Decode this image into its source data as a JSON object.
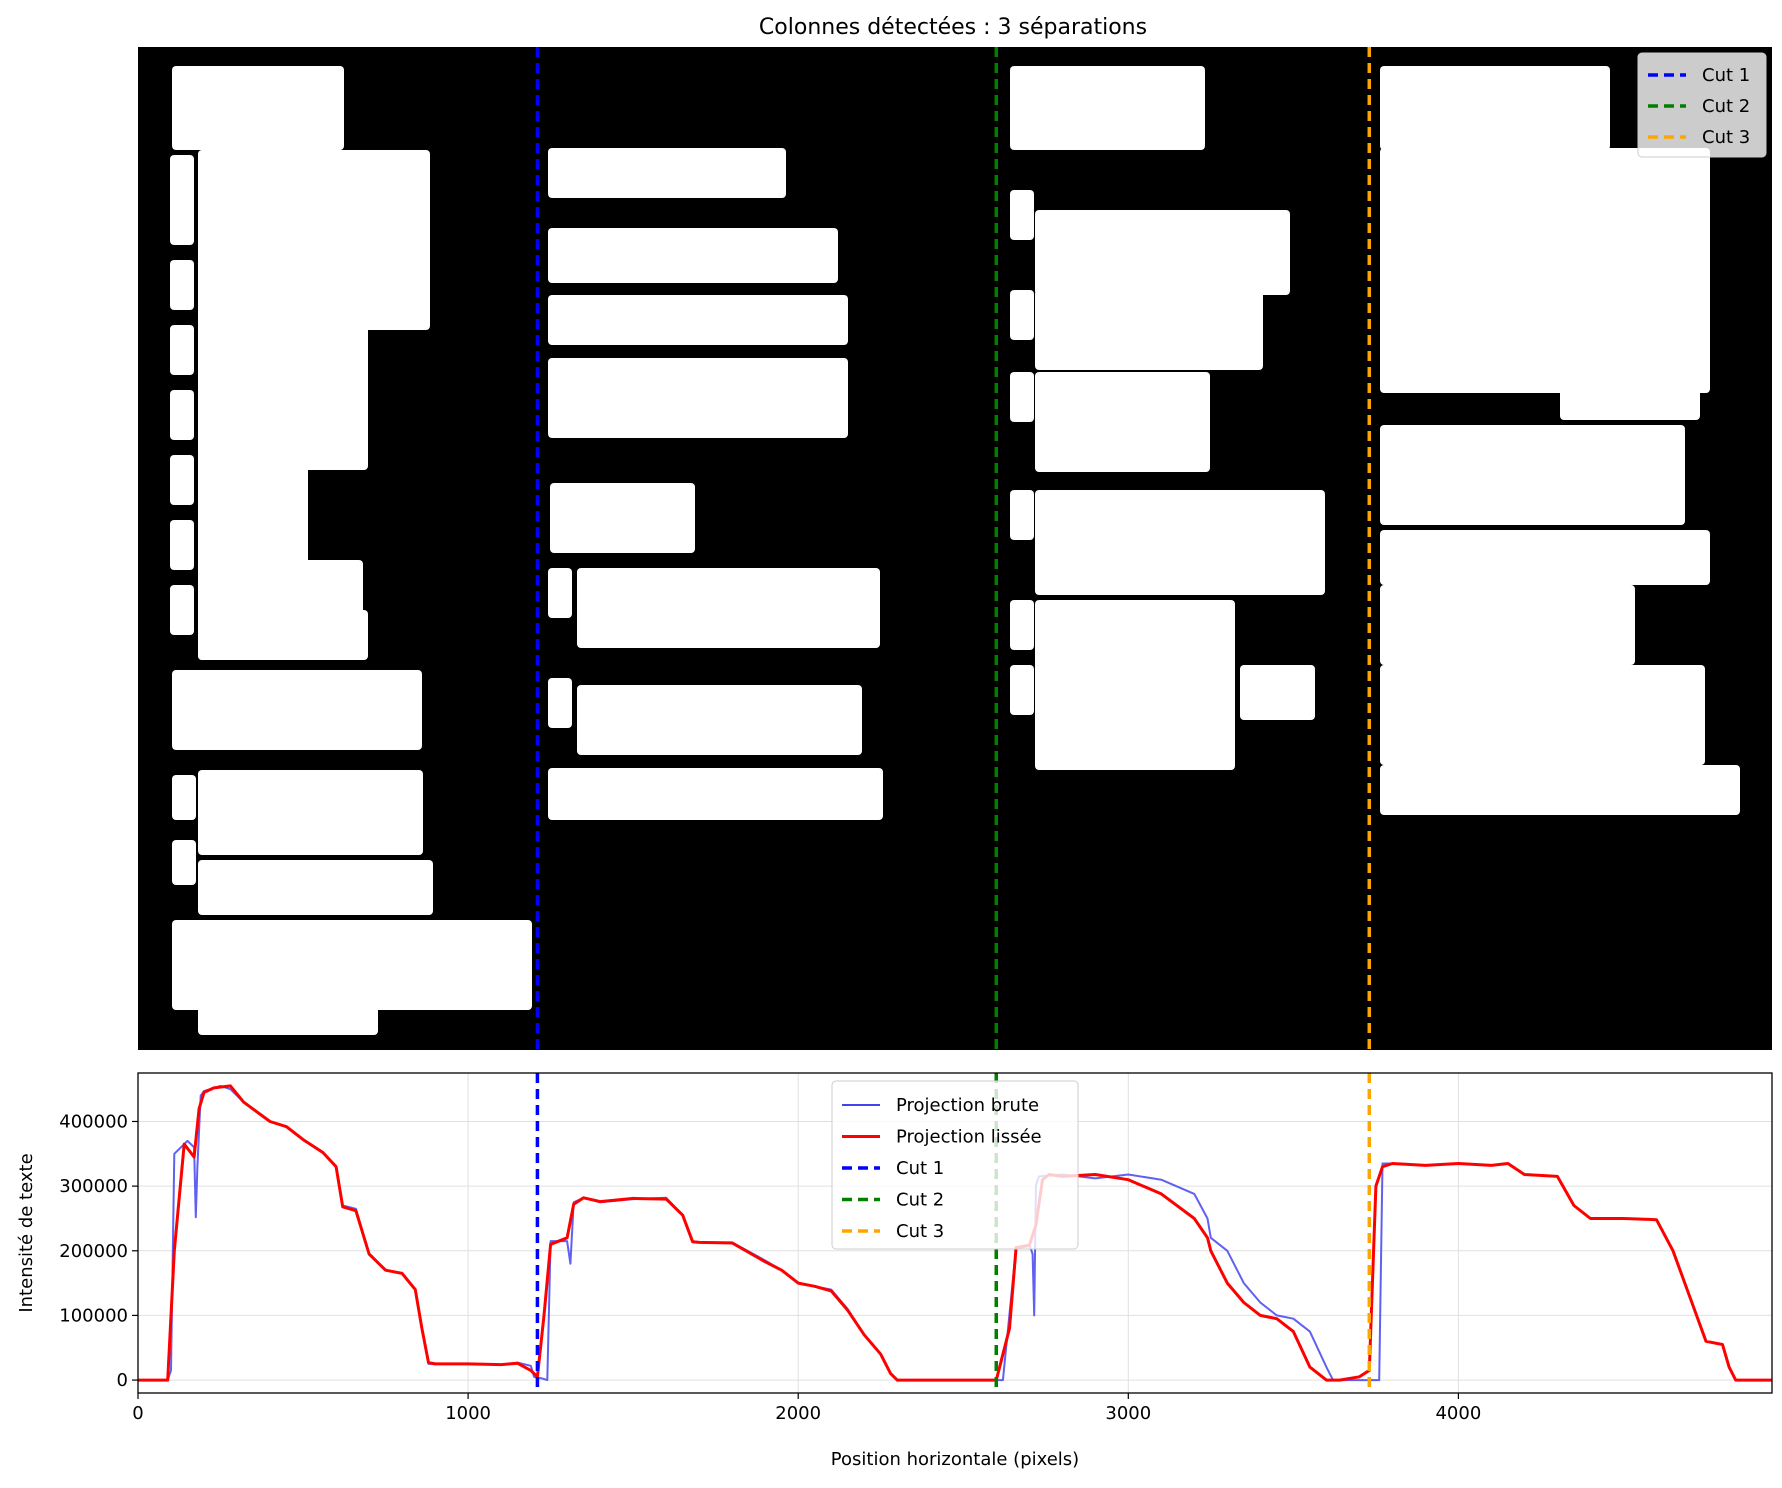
{
  "figure": {
    "title": "Colonnes détectées : 3 séparations"
  },
  "chart_data": [
    {
      "type": "image",
      "description_role": "binarized-page-mask",
      "x_range": [
        0,
        4950
      ],
      "cuts": [
        {
          "name": "Cut 1",
          "x": 1210,
          "color": "#0000ff"
        },
        {
          "name": "Cut 2",
          "x": 2600,
          "color": "#008000"
        },
        {
          "name": "Cut 3",
          "x": 3730,
          "color": "#ffa500"
        }
      ],
      "legend": {
        "placement": "top-right",
        "entries": [
          "Cut 1",
          "Cut 2",
          "Cut 3"
        ]
      },
      "background_color": "#000000",
      "foreground_color": "#ffffff"
    },
    {
      "type": "line",
      "xlabel": "Position horizontale (pixels)",
      "ylabel": "Intensité de texte",
      "xlim": [
        0,
        4950
      ],
      "ylim": [
        -20000,
        475000
      ],
      "xticks": [
        0,
        1000,
        2000,
        3000,
        4000
      ],
      "yticks": [
        0,
        100000,
        200000,
        300000,
        400000
      ],
      "grid": true,
      "legend": {
        "placement": "top-center",
        "entries": [
          "Projection brute",
          "Projection lissée",
          "Cut 1",
          "Cut 2",
          "Cut 3"
        ]
      },
      "cuts": [
        {
          "name": "Cut 1",
          "x": 1210,
          "color": "#0000ff"
        },
        {
          "name": "Cut 2",
          "x": 2600,
          "color": "#008000"
        },
        {
          "name": "Cut 3",
          "x": 3730,
          "color": "#ffa500"
        }
      ],
      "series": [
        {
          "name": "Projection brute",
          "color": "#4444ee",
          "x": [
            0,
            90,
            100,
            110,
            150,
            170,
            175,
            180,
            190,
            200,
            250,
            280,
            320,
            400,
            450,
            500,
            560,
            600,
            620,
            660,
            700,
            750,
            800,
            840,
            860,
            880,
            900,
            1000,
            1100,
            1150,
            1190,
            1200,
            1210,
            1220,
            1240,
            1250,
            1300,
            1310,
            1320,
            1350,
            1400,
            1500,
            1600,
            1650,
            1680,
            1700,
            1800,
            1900,
            1950,
            2000,
            2050,
            2100,
            2150,
            2200,
            2250,
            2280,
            2300,
            2400,
            2500,
            2600,
            2610,
            2620,
            2660,
            2700,
            2710,
            2715,
            2720,
            2725,
            2730,
            2800,
            2900,
            3000,
            3100,
            3200,
            3240,
            3250,
            3300,
            3350,
            3400,
            3450,
            3500,
            3550,
            3600,
            3620,
            3640,
            3650,
            3700,
            3730,
            3750,
            3760,
            3770,
            3800,
            3900,
            4000,
            4100,
            4150,
            4200,
            4300,
            4350,
            4400,
            4500,
            4600,
            4650,
            4700,
            4750,
            4800,
            4820,
            4840,
            4850,
            4950
          ],
          "y": [
            0,
            0,
            15000,
            350000,
            370000,
            360000,
            252000,
            330000,
            440000,
            447000,
            455000,
            450000,
            430000,
            400000,
            392000,
            372000,
            352000,
            330000,
            270000,
            265000,
            195000,
            170000,
            165000,
            140000,
            80000,
            25000,
            25000,
            25000,
            24000,
            27000,
            22000,
            5000,
            3000,
            3000,
            0,
            215000,
            215000,
            180000,
            275000,
            282000,
            275000,
            280000,
            282000,
            255000,
            215000,
            213000,
            213000,
            185000,
            170000,
            150000,
            145000,
            140000,
            110000,
            70000,
            40000,
            10000,
            0,
            0,
            0,
            0,
            0,
            0,
            205000,
            210000,
            195000,
            100000,
            300000,
            310000,
            315000,
            318000,
            312000,
            318000,
            310000,
            288000,
            250000,
            220000,
            200000,
            150000,
            120000,
            100000,
            95000,
            75000,
            20000,
            0,
            0,
            0,
            0,
            0,
            0,
            0,
            335000,
            335000,
            332000,
            335000,
            332000,
            335000,
            318000,
            315000,
            270000,
            250000,
            250000,
            248000,
            200000,
            130000,
            60000,
            55000,
            20000,
            0,
            0,
            0
          ]
        },
        {
          "name": "Projection lissée",
          "color": "#ff0000",
          "x": [
            0,
            90,
            110,
            140,
            170,
            185,
            200,
            230,
            280,
            320,
            400,
            450,
            500,
            560,
            600,
            620,
            660,
            700,
            750,
            800,
            840,
            860,
            880,
            900,
            1000,
            1100,
            1150,
            1190,
            1210,
            1230,
            1250,
            1300,
            1320,
            1350,
            1400,
            1500,
            1600,
            1650,
            1680,
            1700,
            1800,
            1900,
            1950,
            2000,
            2050,
            2100,
            2150,
            2200,
            2250,
            2280,
            2300,
            2400,
            2500,
            2600,
            2640,
            2660,
            2700,
            2720,
            2740,
            2760,
            2800,
            2900,
            3000,
            3100,
            3200,
            3240,
            3250,
            3300,
            3350,
            3400,
            3450,
            3500,
            3550,
            3600,
            3620,
            3640,
            3700,
            3730,
            3750,
            3770,
            3800,
            3900,
            4000,
            4100,
            4150,
            4200,
            4300,
            4350,
            4400,
            4500,
            4600,
            4650,
            4700,
            4750,
            4800,
            4820,
            4840,
            4860,
            4950
          ],
          "y": [
            0,
            0,
            200000,
            365000,
            345000,
            420000,
            445000,
            452000,
            455000,
            430000,
            400000,
            392000,
            372000,
            352000,
            330000,
            268000,
            262000,
            195000,
            170000,
            165000,
            140000,
            80000,
            27000,
            25000,
            25000,
            24000,
            26000,
            15000,
            5000,
            100000,
            210000,
            220000,
            272000,
            282000,
            276000,
            281000,
            280000,
            255000,
            214000,
            213000,
            212000,
            183000,
            170000,
            150000,
            145000,
            138000,
            108000,
            70000,
            40000,
            10000,
            0,
            0,
            0,
            0,
            80000,
            205000,
            208000,
            240000,
            310000,
            318000,
            315000,
            318000,
            310000,
            288000,
            250000,
            220000,
            200000,
            150000,
            120000,
            100000,
            95000,
            75000,
            20000,
            0,
            0,
            0,
            5000,
            15000,
            300000,
            330000,
            335000,
            332000,
            335000,
            332000,
            335000,
            318000,
            315000,
            270000,
            250000,
            250000,
            248000,
            200000,
            130000,
            60000,
            55000,
            20000,
            0,
            0,
            0
          ]
        }
      ]
    }
  ]
}
